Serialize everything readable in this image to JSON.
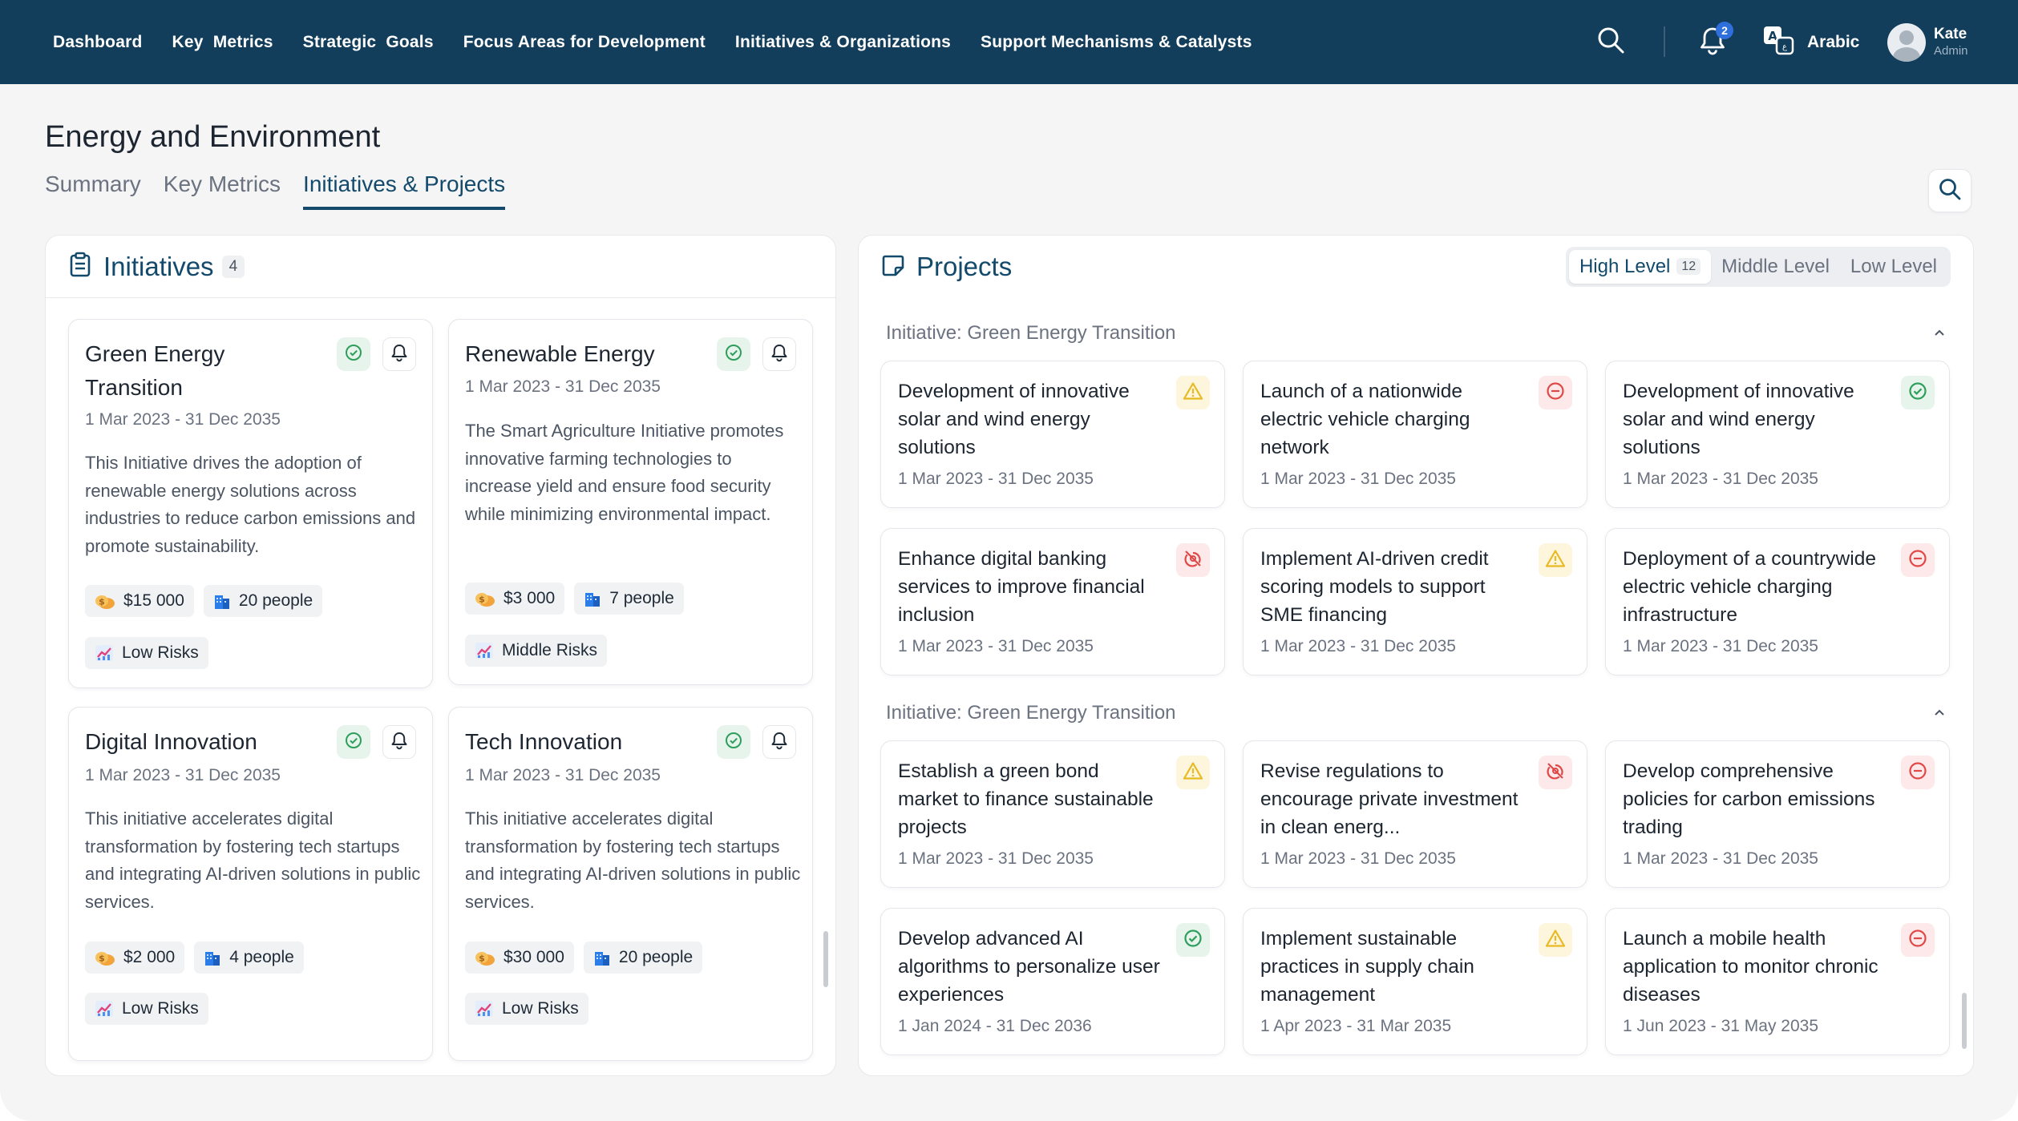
{
  "colors": {
    "brand": "#123e5c",
    "accent": "#134a6c",
    "ok": "#2e9e5b",
    "warning": "#e8b923",
    "danger": "#e04848"
  },
  "topbar": {
    "nav": [
      "Dashboard",
      "Key  Metrics",
      "Strategic  Goals",
      "Focus Areas for Development",
      "Initiatives & Organizations",
      "Support Mechanisms & Catalysts"
    ],
    "notifications_count": "2",
    "language": "Arabic",
    "user": {
      "name": "Kate",
      "role": "Admin"
    }
  },
  "page": {
    "title": "Energy and Environment",
    "tabs": [
      "Summary",
      "Key Metrics",
      "Initiatives & Projects"
    ],
    "active_tab": "Initiatives & Projects"
  },
  "initiatives": {
    "title": "Initiatives",
    "count": "4",
    "cards": [
      {
        "title": "Green Energy Transition",
        "dates": "1 Mar 2023 - 31 Dec 2035",
        "description": "This Initiative drives the adoption of renewable energy solutions across industries to reduce carbon emissions and promote sustainability.",
        "budget": "$15 000",
        "people": "20 people",
        "risk": "Low Risks"
      },
      {
        "title": "Renewable Energy",
        "dates": "1 Mar 2023 - 31 Dec 2035",
        "description": "The Smart Agriculture Initiative promotes innovative farming technologies to increase yield and ensure food security while minimizing environmental impact.",
        "budget": "$3 000",
        "people": "7 people",
        "risk": "Middle Risks"
      },
      {
        "title": "Digital Innovation",
        "dates": "1 Mar 2023 - 31 Dec 2035",
        "description": "This initiative accelerates digital transformation by fostering tech startups and integrating AI-driven solutions in public services.",
        "budget": "$2 000",
        "people": "4 people",
        "risk": "Low Risks"
      },
      {
        "title": "Tech Innovation",
        "dates": "1 Mar 2023 - 31 Dec 2035",
        "description": "This initiative accelerates digital transformation by fostering tech startups and integrating AI-driven solutions in public services.",
        "budget": "$30 000",
        "people": "20 people",
        "risk": "Low Risks"
      }
    ]
  },
  "projects": {
    "title": "Projects",
    "levels": [
      {
        "label": "High Level",
        "count": "12"
      },
      {
        "label": "Middle Level",
        "count": ""
      },
      {
        "label": "Low Level",
        "count": ""
      }
    ],
    "active_level": "High Level",
    "groups": [
      {
        "label": "Initiative: Green Energy Transition",
        "items": [
          {
            "title": "Development of innovative solar and wind energy solutions",
            "dates": "1 Mar 2023 - 31 Dec 2035",
            "status": "warning"
          },
          {
            "title": "Launch of a nationwide electric vehicle charging network",
            "dates": "1 Mar 2023 - 31 Dec 2035",
            "status": "blocked"
          },
          {
            "title": "Development of innovative solar and wind energy solutions",
            "dates": "1 Mar 2023 - 31 Dec 2035",
            "status": "ok"
          },
          {
            "title": "Enhance digital banking services to improve financial inclusion",
            "dates": "1 Mar 2023 - 31 Dec 2035",
            "status": "hidden"
          },
          {
            "title": "Implement AI-driven credit scoring models to support SME financing",
            "dates": "1 Mar 2023 - 31 Dec 2035",
            "status": "warning"
          },
          {
            "title": "Deployment of a countrywide electric vehicle charging infrastructure",
            "dates": "1 Mar 2023 - 31 Dec 2035",
            "status": "blocked"
          }
        ]
      },
      {
        "label": "Initiative: Green Energy Transition",
        "items": [
          {
            "title": "Establish a green bond market to finance sustainable projects",
            "dates": "1 Mar 2023 - 31 Dec 2035",
            "status": "warning"
          },
          {
            "title": "Revise regulations to encourage private investment in clean energ...",
            "dates": "1 Mar 2023 - 31 Dec 2035",
            "status": "hidden"
          },
          {
            "title": "Develop comprehensive policies for carbon emissions trading",
            "dates": "1 Mar 2023 - 31 Dec 2035",
            "status": "blocked"
          },
          {
            "title": "Develop advanced AI algorithms to personalize user experiences",
            "dates": "1 Jan 2024 - 31 Dec 2036",
            "status": "ok"
          },
          {
            "title": "Implement sustainable practices in supply chain management",
            "dates": "1 Apr 2023 - 31 Mar 2035",
            "status": "warning"
          },
          {
            "title": "Launch a mobile health application to monitor chronic diseases",
            "dates": "1 Jun 2023 - 31 May 2035",
            "status": "blocked"
          }
        ]
      }
    ]
  }
}
